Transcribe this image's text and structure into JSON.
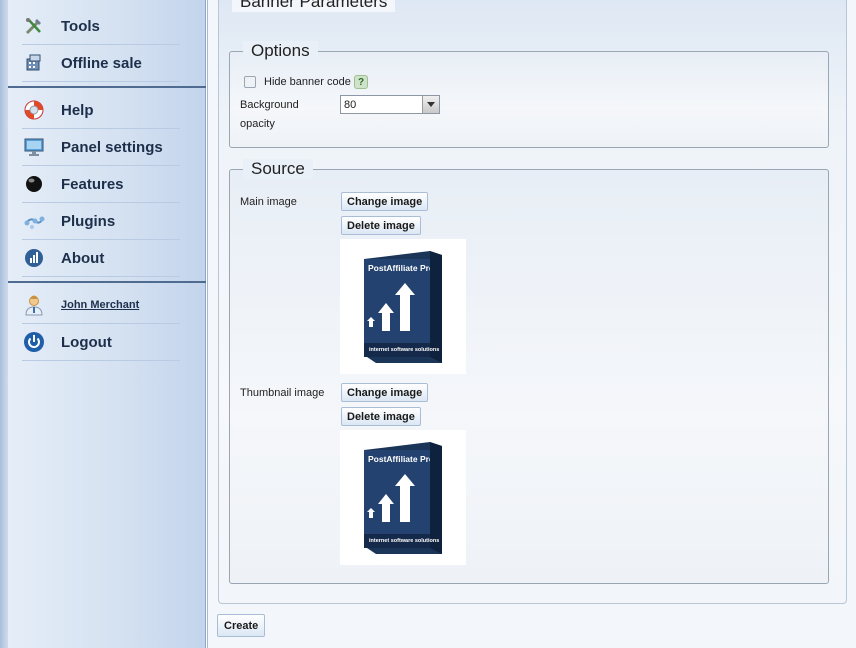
{
  "sidebar": {
    "items": [
      {
        "label": "Tools",
        "icon": "tools-icon"
      },
      {
        "label": "Offline sale",
        "icon": "offline-sale-icon"
      },
      {
        "label": "Help",
        "icon": "lifebuoy-icon"
      },
      {
        "label": "Panel settings",
        "icon": "monitor-icon"
      },
      {
        "label": "Features",
        "icon": "sphere-icon"
      },
      {
        "label": "Plugins",
        "icon": "plugins-icon"
      },
      {
        "label": "About",
        "icon": "about-icon"
      }
    ],
    "user": {
      "name": "John Merchant",
      "icon": "user-icon"
    },
    "logout": {
      "label": "Logout",
      "icon": "power-icon"
    }
  },
  "banner": {
    "title": "Banner Parameters",
    "options": {
      "legend": "Options",
      "hide_code_label": "Hide banner code",
      "help_glyph": "?",
      "bg_label_line1": "Background",
      "bg_label_line2": "opacity",
      "bg_value": "80"
    },
    "source": {
      "legend": "Source",
      "main_image_label": "Main image",
      "thumbnail_label": "Thumbnail image",
      "change_label": "Change image",
      "delete_label": "Delete image",
      "box_brand": "PostAffiliate Pro",
      "box_tagline": "internet software solutions"
    }
  },
  "create_label": "Create",
  "colors": {
    "accent": "#2b5a9e",
    "box_blue": "#23426f",
    "sidebar_separator": "#4f6b90"
  }
}
